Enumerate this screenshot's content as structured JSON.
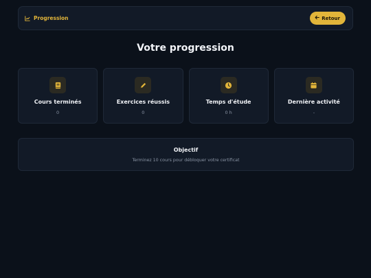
{
  "header": {
    "brand_icon": "chart-line-icon",
    "brand_label": "Progression",
    "back_icon": "arrow-left-icon",
    "back_label": "Retour"
  },
  "title": "Votre progression",
  "stats": [
    {
      "icon": "book-icon",
      "label": "Cours terminés",
      "value": "0"
    },
    {
      "icon": "pencil-icon",
      "label": "Exercices réussis",
      "value": "0"
    },
    {
      "icon": "clock-icon",
      "label": "Temps d'étude",
      "value": "0 h"
    },
    {
      "icon": "calendar-icon",
      "label": "Dernière activité",
      "value": "-"
    }
  ],
  "objective": {
    "title": "Objectif",
    "text": "Terminez 10 cours pour débloquer votre certificat"
  },
  "colors": {
    "background": "#0b111a",
    "card": "#121a27",
    "accent": "#e2b53a",
    "muted_text": "#8b95a5"
  }
}
